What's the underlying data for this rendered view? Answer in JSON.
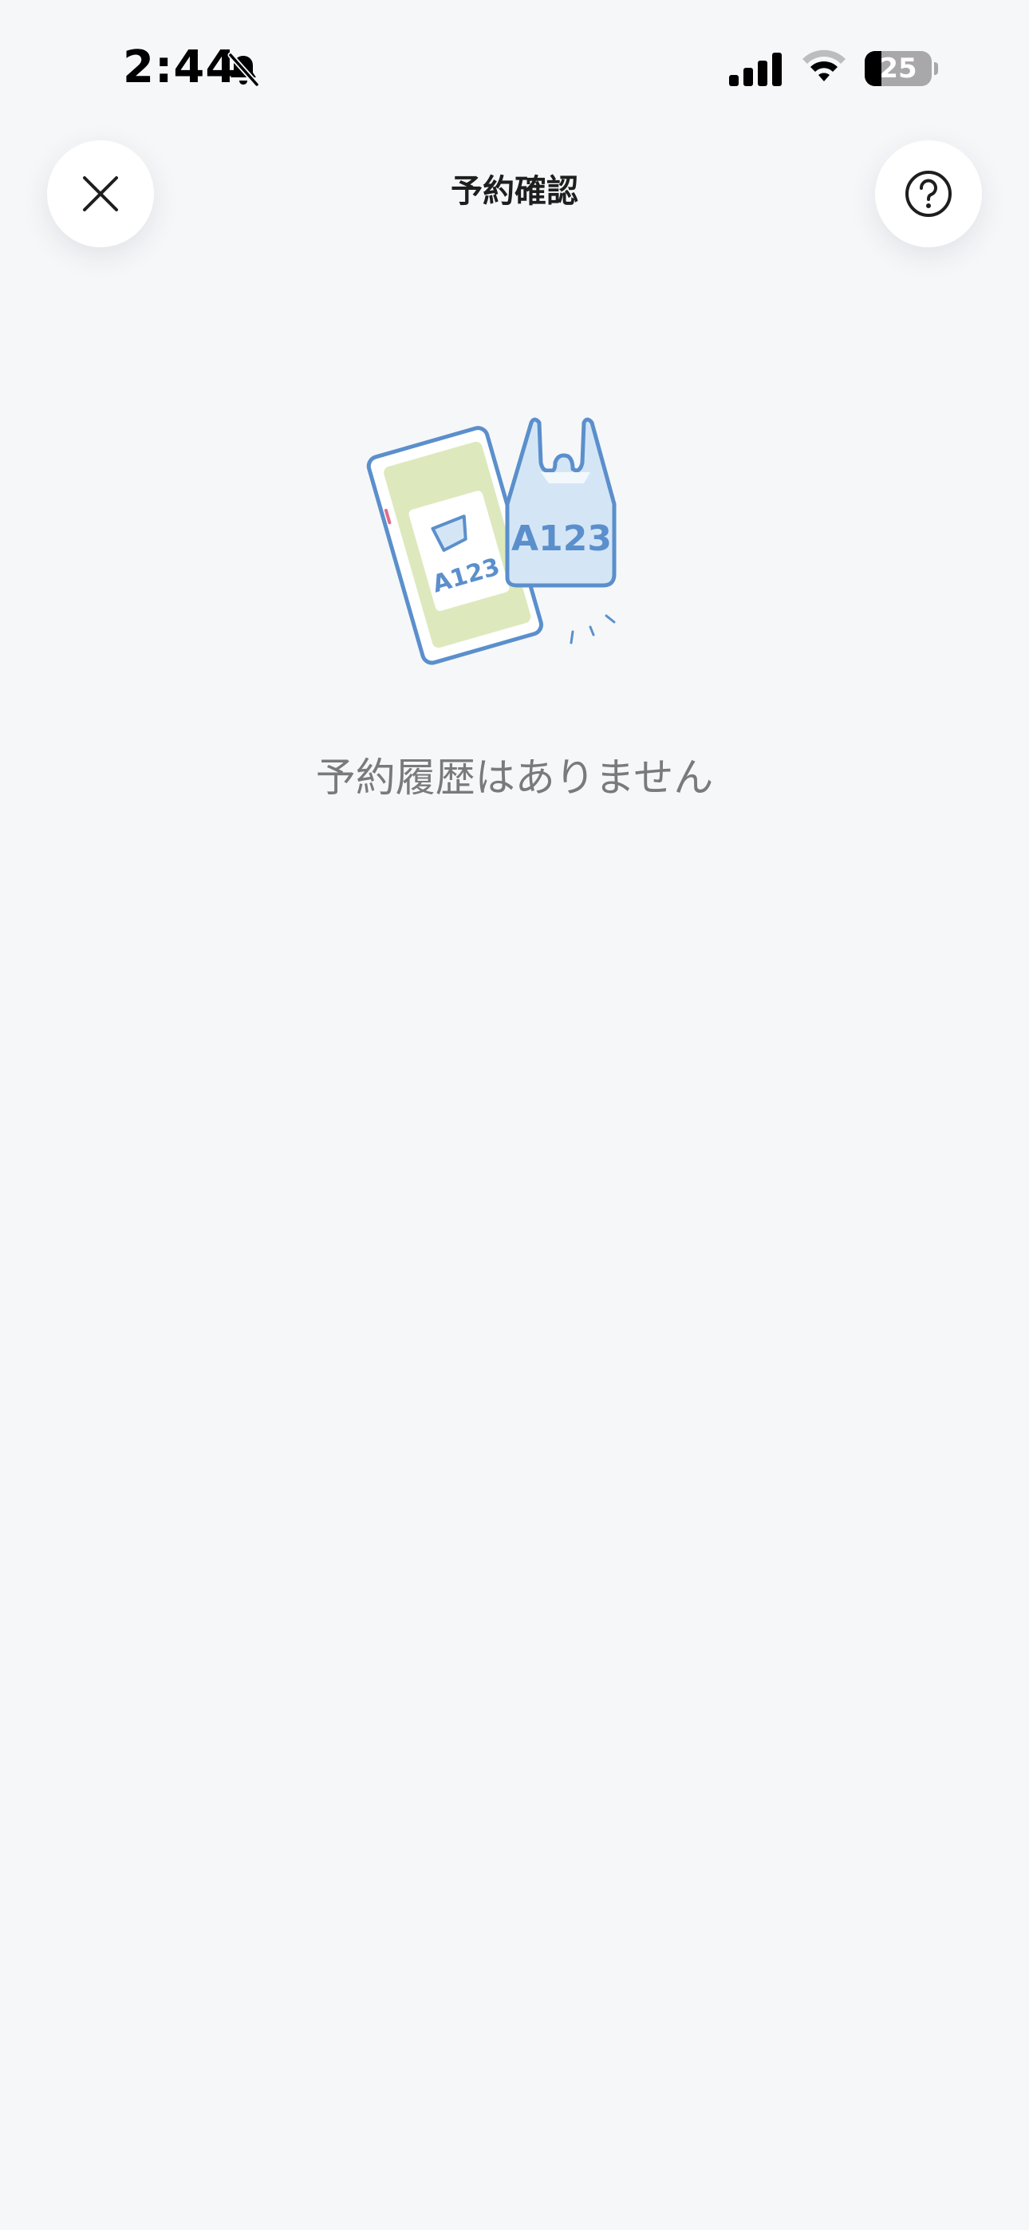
{
  "status_bar": {
    "time": "2:44",
    "battery_level": "25",
    "battery_fraction": 0.25
  },
  "header": {
    "title": "予約確認",
    "close_icon": "close-icon",
    "help_icon": "question-circle-icon"
  },
  "empty_state": {
    "illustration": {
      "phone_code": "A123",
      "bag_code": "A123"
    },
    "message": "予約履歴はありません"
  },
  "colors": {
    "background": "#f6f7f9",
    "illustration_stroke": "#5b8fcc",
    "illustration_green": "#dde9bd",
    "illustration_blue": "#d4e6f6",
    "message_text": "#7a7a7a"
  }
}
